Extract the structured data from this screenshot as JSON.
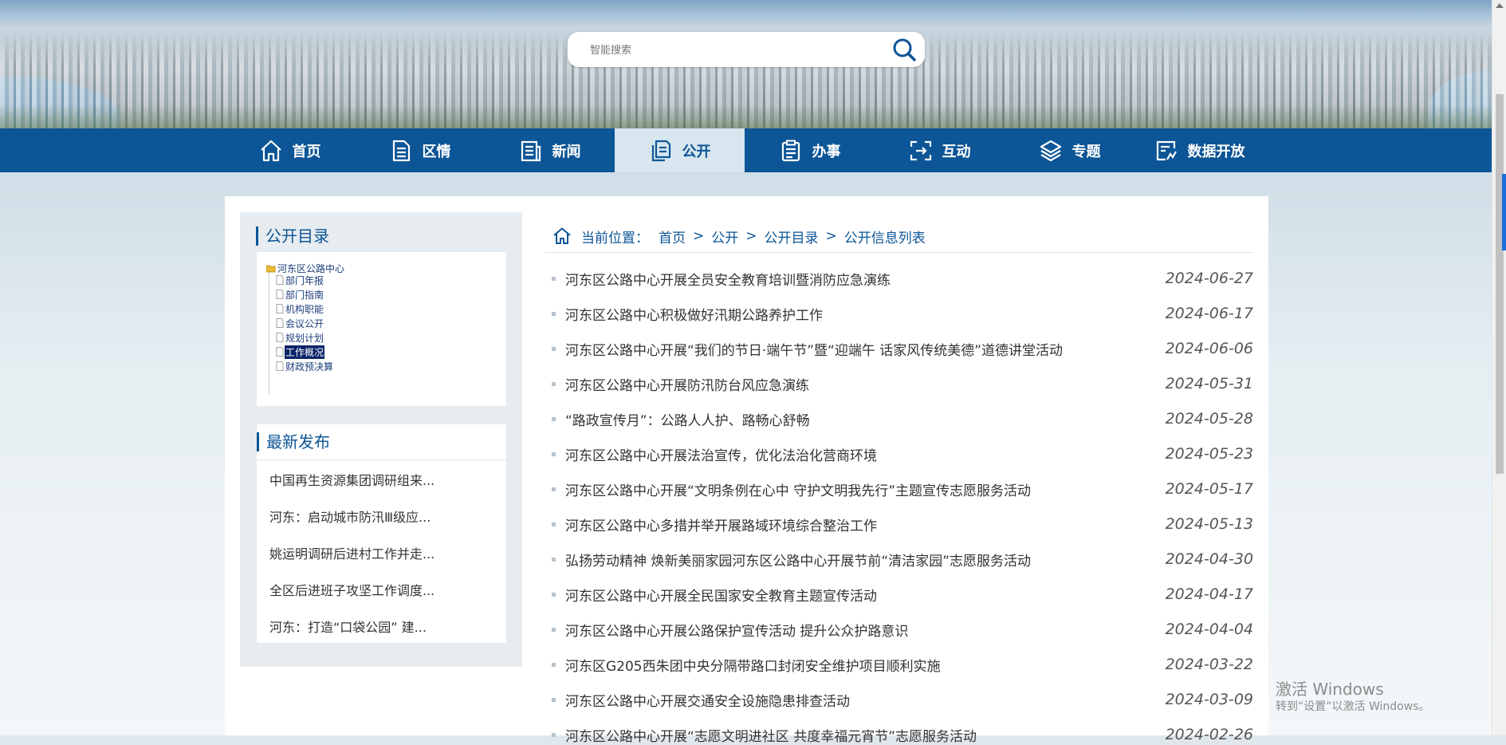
{
  "search": {
    "placeholder": "智能搜索"
  },
  "nav": {
    "items": [
      {
        "label": "首页",
        "icon": "home-icon"
      },
      {
        "label": "区情",
        "icon": "document-lines-icon"
      },
      {
        "label": "新闻",
        "icon": "news-icon"
      },
      {
        "label": "公开",
        "icon": "open-document-icon",
        "active": true
      },
      {
        "label": "办事",
        "icon": "clipboard-icon"
      },
      {
        "label": "互动",
        "icon": "interaction-icon"
      },
      {
        "label": "专题",
        "icon": "layers-icon"
      },
      {
        "label": "数据开放",
        "icon": "data-chart-icon"
      }
    ]
  },
  "catalog": {
    "title": "公开目录",
    "root": "河东区公路中心",
    "items": [
      "部门年报",
      "部门指南",
      "机构职能",
      "会议公开",
      "规划计划",
      "工作概况",
      "财政预决算"
    ],
    "selected": "工作概况"
  },
  "latest": {
    "title": "最新发布",
    "items": [
      "中国再生资源集团调研组来...",
      "河东：启动城市防汛Ⅲ级应...",
      "姚运明调研后进村工作并走...",
      "全区后进班子攻坚工作调度...",
      "河东：打造“口袋公园” 建..."
    ]
  },
  "breadcrumb": {
    "prefix": "当前位置：",
    "items": [
      "首页",
      "公开",
      "公开目录",
      "公开信息列表"
    ],
    "separator": ">"
  },
  "articles": [
    {
      "title": "河东区公路中心开展全员安全教育培训暨消防应急演练",
      "date": "2024-06-27"
    },
    {
      "title": "河东区公路中心积极做好汛期公路养护工作",
      "date": "2024-06-17"
    },
    {
      "title": "河东区公路中心开展“我们的节日·端午节”暨“迎端午 话家风传统美德”道德讲堂活动",
      "date": "2024-06-06"
    },
    {
      "title": "河东区公路中心开展防汛防台风应急演练",
      "date": "2024-05-31"
    },
    {
      "title": "“路政宣传月”：公路人人护、路畅心舒畅",
      "date": "2024-05-28"
    },
    {
      "title": "河东区公路中心开展法治宣传，优化法治化营商环境",
      "date": "2024-05-23"
    },
    {
      "title": "河东区公路中心开展“文明条例在心中 守护文明我先行”主题宣传志愿服务活动",
      "date": "2024-05-17"
    },
    {
      "title": "河东区公路中心多措并举开展路域环境综合整治工作",
      "date": "2024-05-13"
    },
    {
      "title": "弘扬劳动精神 焕新美丽家园河东区公路中心开展节前“清洁家园”志愿服务活动",
      "date": "2024-04-30"
    },
    {
      "title": "河东区公路中心开展全民国家安全教育主题宣传活动",
      "date": "2024-04-17"
    },
    {
      "title": "河东区公路中心开展公路保护宣传活动 提升公众护路意识",
      "date": "2024-04-04"
    },
    {
      "title": "河东区G205西朱团中央分隔带路口封闭安全维护项目顺利实施",
      "date": "2024-03-22"
    },
    {
      "title": "河东区公路中心开展交通安全设施隐患排查活动",
      "date": "2024-03-09"
    },
    {
      "title": "河东区公路中心开展“志愿文明进社区 共度幸福元宵节”志愿服务活动",
      "date": "2024-02-26"
    }
  ],
  "watermark": {
    "line1": "激活 Windows",
    "line2": "转到“设置”以激活 Windows。"
  },
  "colors": {
    "nav_bg": "#0c5596",
    "nav_active_bg": "#d7e6ef",
    "accent": "#0c5596"
  }
}
